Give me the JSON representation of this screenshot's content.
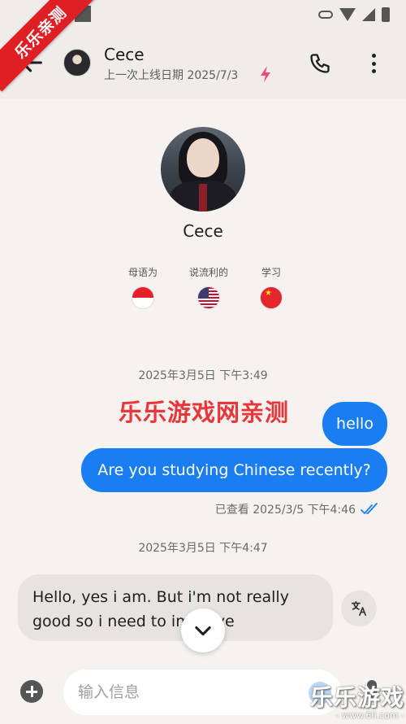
{
  "ribbon": {
    "text": "乐乐亲测"
  },
  "header": {
    "contact_name": "Cece",
    "last_online": "上一次上线日期 2025/7/3",
    "back_icon": "arrow-left-icon",
    "call_icon": "phone-icon",
    "more_icon": "more-vertical-icon",
    "bolt_color": "#f04a78"
  },
  "profile": {
    "name": "Cece",
    "languages": [
      {
        "label": "母语为",
        "flag": "indonesia-flag-icon"
      },
      {
        "label": "说流利的",
        "flag": "usa-flag-icon"
      },
      {
        "label": "学习",
        "flag": "china-flag-icon"
      }
    ]
  },
  "chat": {
    "timestamp_1": "2025年3月5日 下午3:49",
    "watermark_text": "乐乐游戏网亲测",
    "message_1": "hello",
    "message_2": "Are you studying Chinese recently?",
    "seen_status": "已查看 2025/3/5 下午4:46",
    "timestamp_2": "2025年3月5日 下午4:47",
    "message_3": "Hello, yes i am. But i'm not really good so i need to improve",
    "outgoing_color": "#1a7ef2"
  },
  "input": {
    "placeholder": "输入信息"
  },
  "brand": {
    "main": "乐乐游戏",
    "sub": "- www.6ll.com -"
  }
}
